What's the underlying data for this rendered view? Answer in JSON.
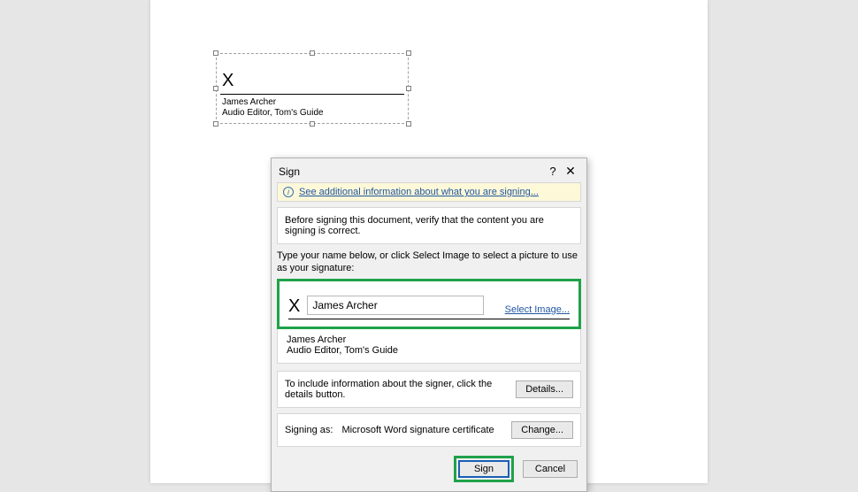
{
  "document": {
    "signature_object": {
      "x_mark": "X",
      "signer_name": "James Archer",
      "signer_title": "Audio Editor, Tom's Guide"
    }
  },
  "dialog": {
    "title": "Sign",
    "help": "?",
    "close": "✕",
    "info_link": "See additional information about what you are signing...",
    "verify_text": "Before signing this document, verify that the content you are signing is correct.",
    "type_name_text": "Type your name below, or click Select Image to select a picture to use as your signature:",
    "input": {
      "x_mark": "X",
      "value": "James Archer",
      "select_image_link": "Select Image..."
    },
    "signer_block": {
      "name": "James Archer",
      "title": "Audio Editor, Tom's Guide"
    },
    "details": {
      "text": "To include information about the signer, click the details button.",
      "button": "Details..."
    },
    "signing_as": {
      "label": "Signing as:",
      "value": "Microsoft Word signature certificate",
      "button": "Change..."
    },
    "buttons": {
      "sign": "Sign",
      "cancel": "Cancel"
    }
  }
}
